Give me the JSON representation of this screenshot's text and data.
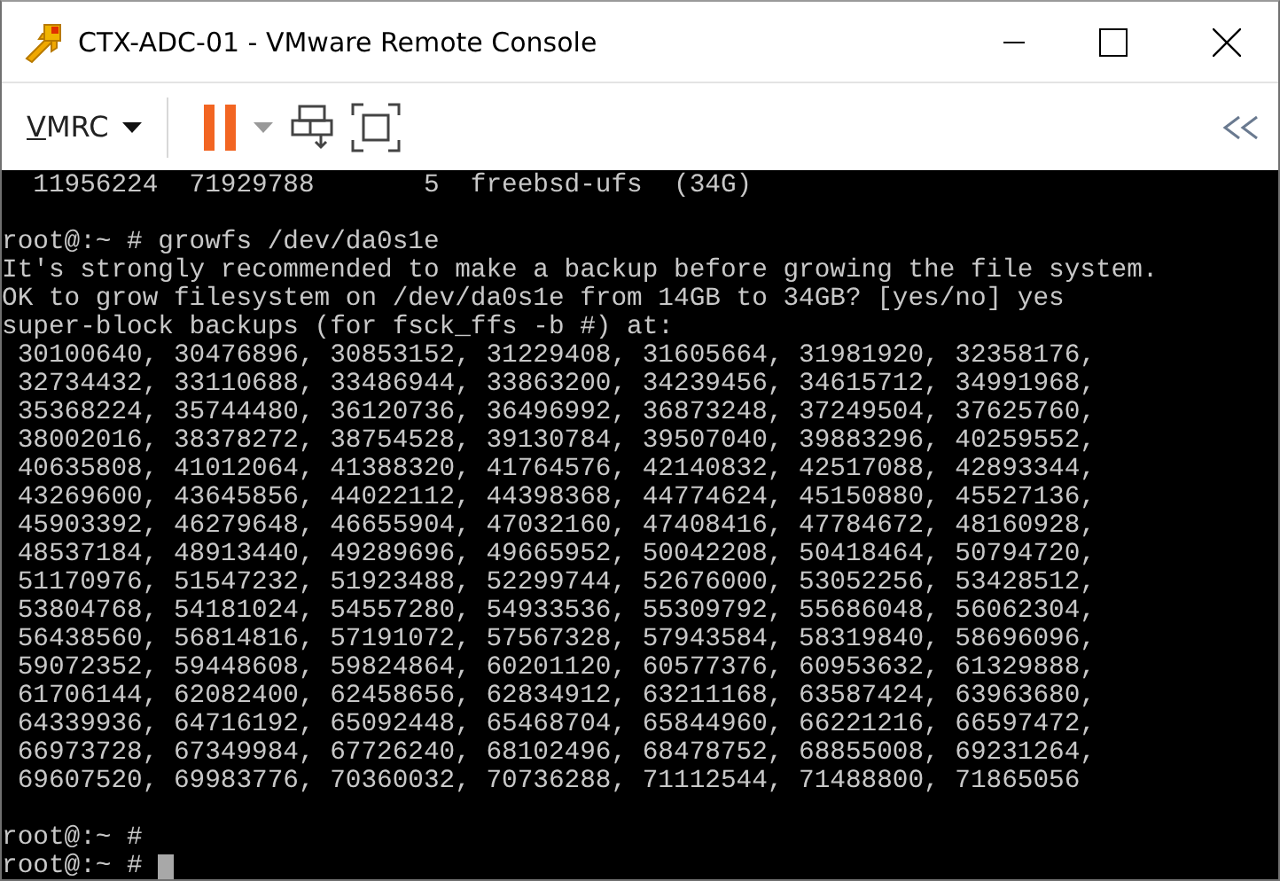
{
  "window": {
    "title": "CTX-ADC-01 - VMware Remote Console"
  },
  "toolbar": {
    "menu_label": "VMRC",
    "paused": true
  },
  "console": {
    "blocks": [
      [
        "  11956224  71929788       5  freebsd-ufs  (34G)"
      ],
      [
        "root@:~ # growfs /dev/da0s1e",
        "It's strongly recommended to make a backup before growing the file system.",
        "OK to grow filesystem on /dev/da0s1e from 14GB to 34GB? [yes/no] yes",
        "super-block backups (for fsck_ffs -b #) at:",
        " 30100640, 30476896, 30853152, 31229408, 31605664, 31981920, 32358176,",
        " 32734432, 33110688, 33486944, 33863200, 34239456, 34615712, 34991968,",
        " 35368224, 35744480, 36120736, 36496992, 36873248, 37249504, 37625760,",
        " 38002016, 38378272, 38754528, 39130784, 39507040, 39883296, 40259552,",
        " 40635808, 41012064, 41388320, 41764576, 42140832, 42517088, 42893344,",
        " 43269600, 43645856, 44022112, 44398368, 44774624, 45150880, 45527136,",
        " 45903392, 46279648, 46655904, 47032160, 47408416, 47784672, 48160928,",
        " 48537184, 48913440, 49289696, 49665952, 50042208, 50418464, 50794720,",
        " 51170976, 51547232, 51923488, 52299744, 52676000, 53052256, 53428512,",
        " 53804768, 54181024, 54557280, 54933536, 55309792, 55686048, 56062304,",
        " 56438560, 56814816, 57191072, 57567328, 57943584, 58319840, 58696096,",
        " 59072352, 59448608, 59824864, 60201120, 60577376, 60953632, 61329888,",
        " 61706144, 62082400, 62458656, 62834912, 63211168, 63587424, 63963680,",
        " 64339936, 64716192, 65092448, 65468704, 65844960, 66221216, 66597472,",
        " 66973728, 67349984, 67726240, 68102496, 68478752, 68855008, 69231264,",
        " 69607520, 69983776, 70360032, 70736288, 71112544, 71488800, 71865056"
      ],
      [
        "root@:~ #",
        "root@:~ #"
      ]
    ],
    "cursor": true
  }
}
